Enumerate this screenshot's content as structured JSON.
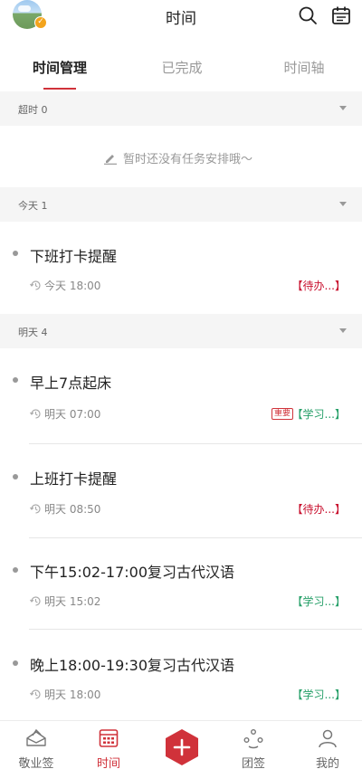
{
  "header": {
    "title": "时间",
    "badge_icon": "check-icon"
  },
  "tabs": [
    {
      "label": "时间管理",
      "active": true
    },
    {
      "label": "已完成",
      "active": false
    },
    {
      "label": "时间轴",
      "active": false
    }
  ],
  "sections": {
    "overdue": {
      "label": "超时 0"
    },
    "today": {
      "label": "今天 1"
    },
    "tomorrow": {
      "label": "明天 4"
    }
  },
  "empty_state": {
    "text": "暂时还没有任务安排哦～"
  },
  "tasks": [
    {
      "name": "下班打卡提醒",
      "time": "今天 18:00",
      "tag": "【待办...】",
      "tag_color": "#c8102e",
      "important": false
    },
    {
      "name": "早上7点起床",
      "time": "明天 07:00",
      "tag": "【学习...】",
      "tag_color": "#27a069",
      "important": true,
      "important_label": "重要"
    },
    {
      "name": "上班打卡提醒",
      "time": "明天 08:50",
      "tag": "【待办...】",
      "tag_color": "#c8102e",
      "important": false
    },
    {
      "name": "下午15:02-17:00复习古代汉语",
      "time": "明天 15:02",
      "tag": "【学习...】",
      "tag_color": "#27a069",
      "important": false
    },
    {
      "name": "晚上18:00-19:30复习古代汉语",
      "time": "明天 18:00",
      "tag": "【学习...】",
      "tag_color": "#27a069",
      "important": false
    }
  ],
  "bottom_nav": [
    {
      "label": "敬业签",
      "icon": "envelope-icon",
      "active": false
    },
    {
      "label": "时间",
      "icon": "calendar-grid-icon",
      "active": true
    },
    {
      "label": "",
      "icon": "plus-icon",
      "active": false
    },
    {
      "label": "团签",
      "icon": "team-icon",
      "active": false
    },
    {
      "label": "我的",
      "icon": "user-icon",
      "active": false
    }
  ],
  "colors": {
    "accent": "#d0323a",
    "todo_red": "#c8102e",
    "study_green": "#27a069"
  }
}
